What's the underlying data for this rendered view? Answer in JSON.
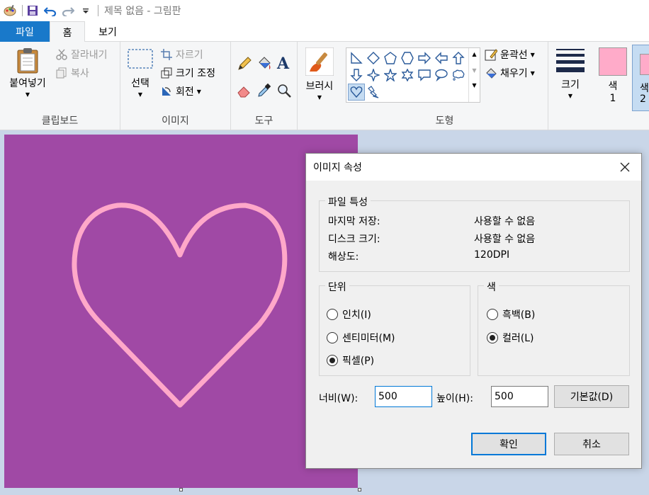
{
  "titlebar": {
    "title": "제목 없음 - 그림판",
    "icons": [
      "paint-app-icon",
      "save-icon",
      "undo-icon",
      "redo-icon",
      "customize-qat-icon"
    ]
  },
  "tabs": {
    "file": "파일",
    "home": "홈",
    "view": "보기"
  },
  "ribbon": {
    "clipboard": {
      "label": "클립보드",
      "paste": "붙여넣기",
      "cut": "잘라내기",
      "copy": "복사"
    },
    "image": {
      "label": "이미지",
      "select": "선택",
      "crop": "자르기",
      "resize": "크기 조정",
      "rotate": "회전"
    },
    "tools": {
      "label": "도구"
    },
    "brush": {
      "label": "브러시"
    },
    "shapes": {
      "label": "도형",
      "outline": "윤곽선",
      "fill": "채우기"
    },
    "size": {
      "label": "크기"
    },
    "colors": {
      "color1_line1": "색",
      "color1_line2": "1",
      "color2_line1": "색",
      "color2_line2": "2",
      "color1_hex": "#ffabc9",
      "color2_hex": "#ffabc9"
    }
  },
  "canvas": {
    "background": "#a049a5",
    "heart_color": "#ffa8c9"
  },
  "dialog": {
    "title": "이미지 속성",
    "file_props": {
      "legend": "파일 특성",
      "last_saved_label": "마지막 저장:",
      "last_saved_value": "사용할 수 없음",
      "disk_size_label": "디스크 크기:",
      "disk_size_value": "사용할 수 없음",
      "resolution_label": "해상도:",
      "resolution_value": "120DPI"
    },
    "units": {
      "legend": "단위",
      "inch": "인치(I)",
      "cm": "센티미터(M)",
      "pixel": "픽셀(P)",
      "selected": "pixel"
    },
    "color": {
      "legend": "색",
      "bw": "흑백(B)",
      "color": "컬러(L)",
      "selected": "color"
    },
    "width_label": "너비(W):",
    "width_value": "500",
    "height_label": "높이(H):",
    "height_value": "500",
    "default_button": "기본값(D)",
    "ok_button": "확인",
    "cancel_button": "취소"
  }
}
